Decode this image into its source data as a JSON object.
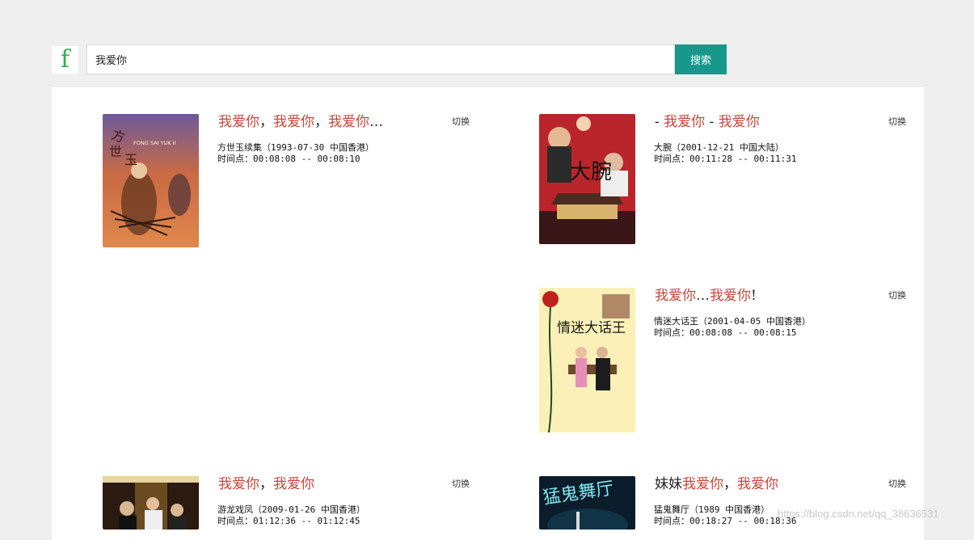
{
  "header": {
    "logo_letter": "f",
    "search_value": "我爱你",
    "search_button_label": "搜索"
  },
  "results": [
    {
      "line_parts": [
        {
          "text": "我爱你",
          "hl": true
        },
        {
          "text": "，",
          "hl": false
        },
        {
          "text": "我爱你",
          "hl": true
        },
        {
          "text": "，",
          "hl": false
        },
        {
          "text": "我爱你",
          "hl": true
        },
        {
          "text": "…",
          "hl": false
        }
      ],
      "switch_label": "切换",
      "movie": "方世玉续集（1993-07-30 中国香港）",
      "timestamp": "时间点：00:08:08 -- 00:08:10",
      "poster_text": "FONG SAI YUK II"
    },
    {
      "line_parts": [
        {
          "text": "- ",
          "hl": false
        },
        {
          "text": "我爱你",
          "hl": true
        },
        {
          "text": " - ",
          "hl": false
        },
        {
          "text": "我爱你",
          "hl": true
        }
      ],
      "switch_label": "切换",
      "movie": "大腕（2001-12-21 中国大陆）",
      "timestamp": "时间点：00:11:28 -- 00:11:31",
      "poster_text": "大腕"
    },
    {
      "line_parts": [
        {
          "text": "我爱你",
          "hl": true
        },
        {
          "text": "…",
          "hl": false
        },
        {
          "text": "我爱你",
          "hl": true
        },
        {
          "text": "!",
          "hl": false
        }
      ],
      "switch_label": "切换",
      "movie": "情迷大话王（2001-04-05 中国香港）",
      "timestamp": "时间点：00:08:08 -- 00:08:15",
      "poster_text": "情迷大话王"
    },
    {
      "line_parts": [
        {
          "text": "我爱你",
          "hl": true
        },
        {
          "text": "，",
          "hl": false
        },
        {
          "text": "我爱你",
          "hl": true
        }
      ],
      "switch_label": "切换",
      "movie": "游龙戏凤（2009-01-26 中国香港）",
      "timestamp": "时间点：01:12:36 -- 01:12:45",
      "poster_text": ""
    },
    {
      "line_parts": [
        {
          "text": "妹妹",
          "hl": false
        },
        {
          "text": "我爱你",
          "hl": true
        },
        {
          "text": "，",
          "hl": false
        },
        {
          "text": "我爱你",
          "hl": true
        }
      ],
      "switch_label": "切换",
      "movie": "猛鬼舞厅（1989 中国香港）",
      "timestamp": "时间点：00:18:27 -- 00:18:36",
      "poster_text": "猛鬼舞厅"
    }
  ],
  "watermark": "https://blog.csdn.net/qq_38636531"
}
